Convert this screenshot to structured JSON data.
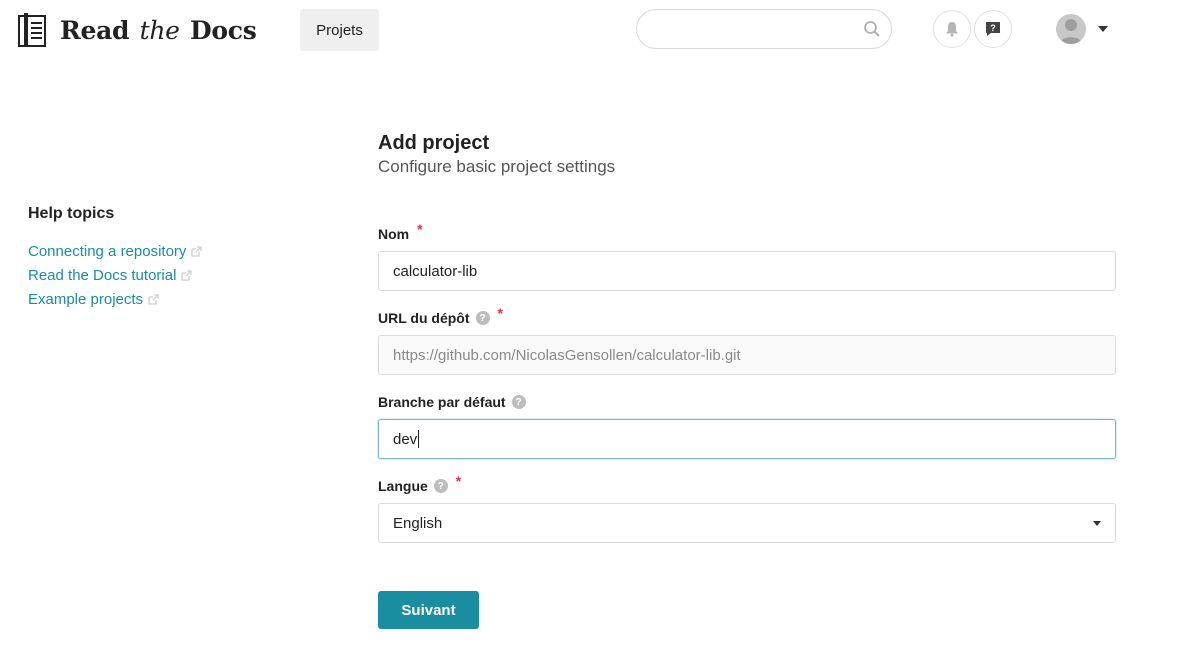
{
  "header": {
    "brand": {
      "word1": "Read",
      "word2": "the",
      "word3": "Docs"
    },
    "nav": {
      "projects_label": "Projets"
    },
    "search": {
      "value": "",
      "placeholder": ""
    },
    "icons": {
      "search": "search-icon",
      "notifications": "bell-icon",
      "help": "help-icon",
      "user": "avatar"
    }
  },
  "sidebar": {
    "title": "Help topics",
    "links": [
      {
        "label": "Connecting a repository"
      },
      {
        "label": "Read the Docs tutorial"
      },
      {
        "label": "Example projects"
      }
    ]
  },
  "main": {
    "title": "Add project",
    "subtitle": "Configure basic project settings",
    "fields": {
      "name": {
        "label": "Nom",
        "required": true,
        "value": "calculator-lib"
      },
      "repo_url": {
        "label": "URL du dépôt",
        "required": true,
        "value": "https://github.com/NicolasGensollen/calculator-lib.git",
        "has_help": true
      },
      "default_branch": {
        "label": "Branche par défaut",
        "required": false,
        "value": "dev",
        "has_help": true
      },
      "language": {
        "label": "Langue",
        "required": true,
        "value": "English",
        "has_help": true
      }
    },
    "required_marker": "*",
    "help_marker": "?",
    "submit_label": "Suivant"
  },
  "colors": {
    "accent": "#1a8da0",
    "required": "#d9363e"
  }
}
